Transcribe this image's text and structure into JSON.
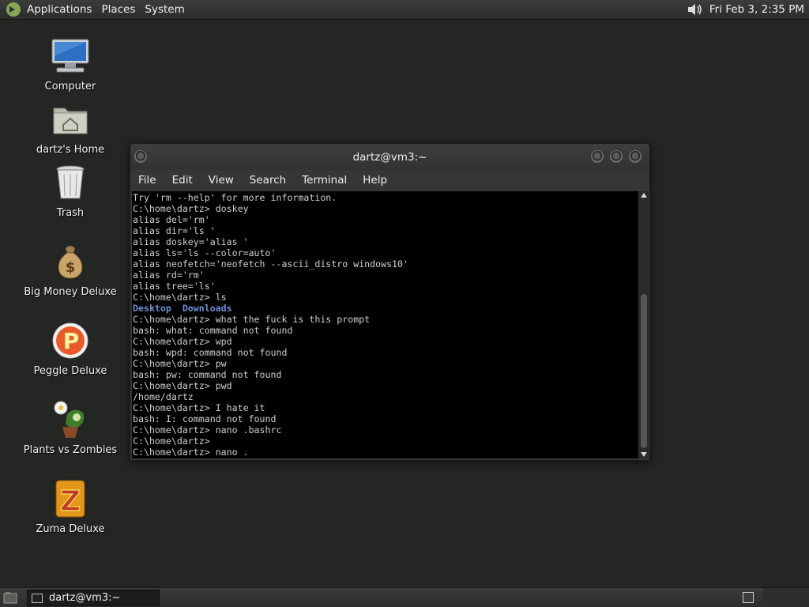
{
  "top_panel": {
    "menus": [
      "Applications",
      "Places",
      "System"
    ],
    "clock": "Fri Feb  3,  2:35 PM",
    "icons": {
      "logo": "mate-logo-icon",
      "volume": "volume-icon"
    }
  },
  "desktop": {
    "icons": [
      {
        "label": "Computer",
        "icon": "computer-icon"
      },
      {
        "label": "dartz's Home",
        "icon": "home-folder-icon"
      },
      {
        "label": "Trash",
        "icon": "trash-icon"
      },
      {
        "label": "Big Money Deluxe",
        "icon": "money-bag-icon"
      },
      {
        "label": "Peggle Deluxe",
        "icon": "peggle-icon"
      },
      {
        "label": "Plants vs Zombies",
        "icon": "plants-vs-zombies-icon"
      },
      {
        "label": "Zuma Deluxe",
        "icon": "zuma-icon"
      }
    ]
  },
  "window": {
    "title": "dartz@vm3:~",
    "menus": [
      "File",
      "Edit",
      "View",
      "Search",
      "Terminal",
      "Help"
    ],
    "terminal_lines": [
      "Try 'rm --help' for more information.",
      "C:\\home\\dartz> doskey",
      "alias del='rm'",
      "alias dir='ls '",
      "alias doskey='alias '",
      "alias ls='ls --color=auto'",
      "alias neofetch='neofetch --ascii_distro windows10'",
      "alias rd='rm'",
      "alias tree='ls'",
      "C:\\home\\dartz> ls",
      "Desktop  Downloads",
      "C:\\home\\dartz> what the fuck is this prompt",
      "bash: what: command not found",
      "C:\\home\\dartz> wpd",
      "bash: wpd: command not found",
      "C:\\home\\dartz> pw",
      "bash: pw: command not found",
      "C:\\home\\dartz> pwd",
      "/home/dartz",
      "C:\\home\\dartz> I hate it",
      "bash: I: command not found",
      "C:\\home\\dartz> nano .bashrc",
      "C:\\home\\dartz>",
      "C:\\home\\dartz> nano ."
    ]
  },
  "bottom_panel": {
    "task_label": "dartz@vm3:~"
  },
  "colors": {
    "desktop_bg": "#232622",
    "terminal_bg": "#000000",
    "terminal_fg": "#d0d0d0",
    "dir_color": "#6f8fd6"
  }
}
